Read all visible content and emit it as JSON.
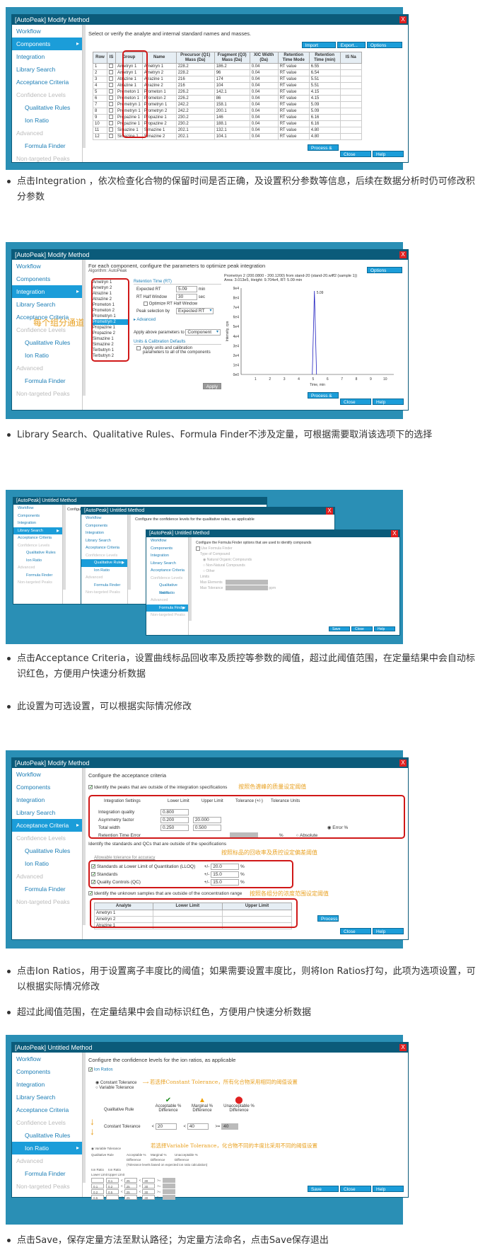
{
  "shot1": {
    "title": "[AutoPeak] Modify Method",
    "close": "X",
    "nav": [
      "Workflow",
      "Components",
      "Integration",
      "Library Search",
      "Acceptance Criteria",
      "Confidence Levels",
      "Qualitative Rules",
      "Ion Ratio",
      "Advanced",
      "Formula Finder",
      "Non-targeted Peaks"
    ],
    "instruction": "Select or verify the analyte and internal standard names and masses.",
    "top_buttons": [
      "Import",
      "Export...",
      "Options"
    ],
    "columns": [
      "Row",
      "IS",
      "Group",
      "Name",
      "Precursor (Q1) Mass (Da)",
      "Fragment (Q3) Mass (Da)",
      "XIC Width (Da)",
      "Retention Time Mode",
      "Retention Time (min)",
      "IS Na"
    ],
    "rows": [
      [
        "1",
        "Ametryn 1",
        "Ametryn 1",
        "228.2",
        "186.2",
        "0.04",
        "RT value",
        "6.55"
      ],
      [
        "2",
        "Ametryn 1",
        "Ametryn 2",
        "228.2",
        "96",
        "0.04",
        "RT value",
        "6.54"
      ],
      [
        "3",
        "Atrazine 1",
        "Atrazine 1",
        "216",
        "174",
        "0.04",
        "RT value",
        "5.51"
      ],
      [
        "4",
        "Atrazine 1",
        "Atrazine 2",
        "216",
        "104",
        "0.04",
        "RT value",
        "5.51"
      ],
      [
        "5",
        "Prometon 1",
        "Prometon 1",
        "226.2",
        "142.1",
        "0.04",
        "RT value",
        "4.15"
      ],
      [
        "6",
        "Prometon 1",
        "Prometon 2",
        "226.2",
        "86",
        "0.04",
        "RT value",
        "4.15"
      ],
      [
        "7",
        "Prometryn 1",
        "Prometryn 1",
        "242.2",
        "158.1",
        "0.04",
        "RT value",
        "5.09"
      ],
      [
        "8",
        "Prometryn 1",
        "Prometryn 2",
        "242.2",
        "200.1",
        "0.04",
        "RT value",
        "5.09"
      ],
      [
        "9",
        "Propazine 1",
        "Propazine 1",
        "230.2",
        "146",
        "0.04",
        "RT value",
        "6.16"
      ],
      [
        "10",
        "Propazine 1",
        "Propazine 2",
        "230.2",
        "188.1",
        "0.04",
        "RT value",
        "6.16"
      ],
      [
        "11",
        "Simazine 1",
        "Simazine 1",
        "202.1",
        "132.1",
        "0.04",
        "RT value",
        "4.80"
      ],
      [
        "12",
        "Simazine 1",
        "Simazine 2",
        "202.1",
        "104.1",
        "0.04",
        "RT value",
        "4.80"
      ]
    ],
    "bottom_buttons": [
      "Process & Close",
      "Close",
      "Help"
    ]
  },
  "p1": "点击Integration ，依次检查化合物的保留时间是否正确，及设置积分参数等信息，后续在数据分析时仍可修改积分参数",
  "shot2": {
    "title": "[AutoPeak] Modify Method",
    "instruction": "For each component, configure the parameters to optimize peak integration",
    "algorithm": "Algorithm: AutoPeak",
    "options": "Options",
    "components": [
      "Ametryn 1",
      "Ametryn 2",
      "Atrazine 1",
      "Atrazine 2",
      "Prometon 1",
      "Prometon 2",
      "Prometryn 1",
      "Prometryn 2",
      "Propazine 1",
      "Propazine 2",
      "Simazine 1",
      "Simazine 2",
      "Terbutryn 1",
      "Terbutryn 2"
    ],
    "selected_component": "Prometryn 2",
    "annotation": "每个组分通道",
    "rt_header": "Retention Time (RT)",
    "expected_rt_label": "Expected RT",
    "expected_rt": "5.09",
    "min": "min",
    "rt_half_label": "RT Half Window",
    "rt_half": "30",
    "sec": "sec",
    "optimize": "Optimize RT Half Window",
    "peak_sel_label": "Peak selection by",
    "peak_sel": "Expected RT",
    "advanced": "Advanced",
    "apply_label": "Apply above parameters to",
    "apply_value": "Component",
    "units_header": "Units & Calibration Defaults",
    "units_text": "Apply units and calibration parameters to all of the components",
    "apply_btn": "Apply",
    "plot_title": "Prometryn 2 (200.0800 - 200.1200) from stand-20 (stand-20.wiff2 (sample 1))",
    "plot_sub": "Area: 3.013e5, Height: 9.704e4, RT: 5.09 min",
    "peak_label": "5.09",
    "ylabel": "Intensity, cps",
    "xlabel": "Time, min",
    "yticks": [
      "9e4",
      "8e4",
      "7e4",
      "6e4",
      "5e4",
      "4e4",
      "3e4",
      "2e4",
      "1e4",
      "0e0"
    ],
    "xticks": [
      "1",
      "2",
      "3",
      "4",
      "5",
      "6",
      "7",
      "8",
      "9",
      "10"
    ]
  },
  "p2": "Library Search、Qualitative Rules、Formula Finder不涉及定量，可根据需要取消该选项下的选择",
  "shot3": {
    "title_a": "[AutoPeak] Untitled Method",
    "title_b": "[AutoPeak] Untitled Method",
    "title_c": "[AutoPeak] Untitled Method",
    "text_a": "Configure",
    "text_b": "Configure the confidence levels for the qualitative rules, as applicable",
    "text_c": "Configure the Formula Finder options that are used to identify compounds",
    "use_ff": "Use Formula Finder",
    "type_comp": "Type of Compound",
    "opt1": "Natural Organic Compounds",
    "opt2": "Non-Natural Compounds",
    "opt3": "Other",
    "limits": "Limits",
    "max_elements": "Max Elements",
    "max_tol": "Max Tolerance",
    "ppm": "ppm"
  },
  "p3": "点击Acceptance Criteria，设置曲线标品回收率及质控等参数的阈值，超过此阈值范围，在定量结果中会自动标识红色，方便用户快速分析数据",
  "p4": "此设置为可选设置，可以根据实际情况修改",
  "shot4": {
    "title": "[AutoPeak] Modify Method",
    "instruction": "Configure the acceptance criteria",
    "chk1": "Identify the peaks that are outside of the integration specifications",
    "ann1": "按照色谱峰的质量设定阈值",
    "headers": [
      "Integration Settings",
      "Lower Limit",
      "Upper Limit",
      "Tolerance (+/-)",
      "Tolerance Units"
    ],
    "int_quality": "Integration quality",
    "int_quality_val": "0.800",
    "asym": "Asymmetry factor",
    "asym_low": "0.200",
    "asym_high": "20.000",
    "total_width": "Total width",
    "tw_low": "0.250",
    "tw_high": "0.500",
    "error_pct": "Error %",
    "rt_error": "Retention Time Error",
    "absolute": "Absolute",
    "pct": "%",
    "chk2": "Identify the standards and QCs that are outside of the specifications",
    "ann2": "按照标品的回收率及质控设定偏差阈值",
    "accuracy": "Allowable tolerance for accuracy",
    "lloq": "Standards at Lower Limit of Quantitation (LLOQ)",
    "lloq_val": "20.0",
    "standards": "Standards",
    "std_val": "15.0",
    "qc": "Quality Controls (QC)",
    "qc_val": "15.0",
    "pm": "+/-",
    "chk3": "Identify the unknown samples that are outside of the concentration range",
    "ann3": "按照各组分的浓度范围设定阈值",
    "analyte_headers": [
      "Analyte",
      "Lower Limit",
      "Upper Limit"
    ],
    "analytes": [
      "Ametryn 1",
      "Ametryn 2",
      "Atrazine 1"
    ]
  },
  "p5": "点击Ion Ratios，用于设置离子丰度比的阈值；如果需要设置丰度比，则将Ion Ratios打勾，此项为选项设置，可以根据实际情况修改",
  "p6": "超过此阈值范围，在定量结果中会自动标识红色，方便用户快速分析数据",
  "shot5": {
    "title": "[AutoPeak] Untitled Method",
    "instruction": "Configure the confidence levels for the ion ratios, as applicable",
    "ion_ratios": "Ion Ratios",
    "const_tol": "Constant Tolerance",
    "var_tol": "Variable Tolerance",
    "ann1": "若选择Constant Tolerance，所有化合物采用相同的阈值设置",
    "qual_rule": "Qualitative Rule",
    "acceptable": "Acceptable % Difference",
    "marginal": "Marginal % Difference",
    "unacceptable": "Unacceptable % Difference",
    "const_label": "Constant Tolerance",
    "lt": "<",
    "gte": ">=",
    "acc_val": "20",
    "mar_val": "40",
    "ann2": "若选择Variable Tolerance，化合物不同的丰度比采用不同的阈值设置",
    "var_note": "(Tolerance levels based on expected ion ratio calculation)",
    "ion_ratio_lower": "Ion Ratio Lower Limit",
    "ion_ratio_upper": "Ion Ratio Upper Limit",
    "var_rows": [
      [
        "",
        "0.1",
        "25",
        "30"
      ],
      [
        "0.1",
        "0.2",
        "25",
        "30"
      ],
      [
        "0.2",
        "0.5",
        "25",
        "30"
      ],
      [
        "0.5",
        "",
        "25",
        "30"
      ]
    ],
    "bottom_buttons": [
      "Save",
      "Close",
      "Help"
    ]
  },
  "p7": "点击Save，保存定量方法至默认路径；为定量方法命名，点击Save保存退出",
  "colors": {
    "accent": "#1b9dd9",
    "titlebar": "#0b5b7a",
    "frame": "#2a8fb5",
    "red": "#d01818",
    "annotation": "#e8a020"
  }
}
